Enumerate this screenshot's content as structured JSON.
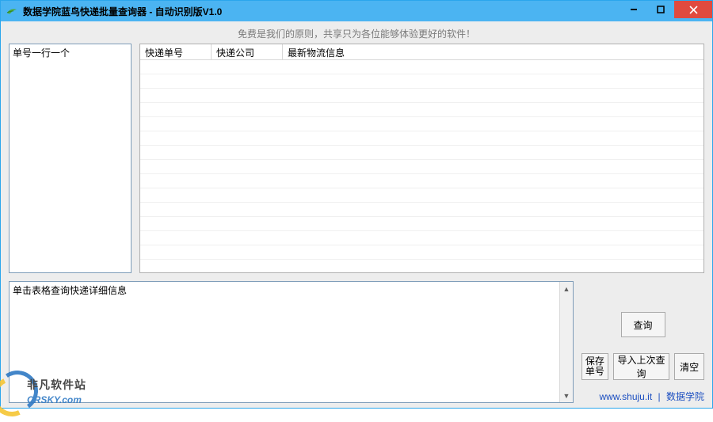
{
  "titlebar": {
    "title": "数据学院蓝鸟快递批量查询器 - 自动识别版V1.0"
  },
  "slogan": "免费是我们的原则，共享只为各位能够体验更好的软件！",
  "input_panel": {
    "hint": "单号一行一个",
    "value": ""
  },
  "table": {
    "columns": [
      "快递单号",
      "快递公司",
      "最新物流信息"
    ],
    "rows": []
  },
  "detail": {
    "label": "单击表格查询快递详细信息",
    "value": ""
  },
  "buttons": {
    "query": "查询",
    "save": "保存\n单号",
    "import": "导入上次查询",
    "clear": "清空"
  },
  "footer": {
    "link1_text": "www.shuju.it",
    "link2_text": "数据学院"
  },
  "watermark": {
    "name": "非凡软件站",
    "url": "CRSKY.com"
  }
}
